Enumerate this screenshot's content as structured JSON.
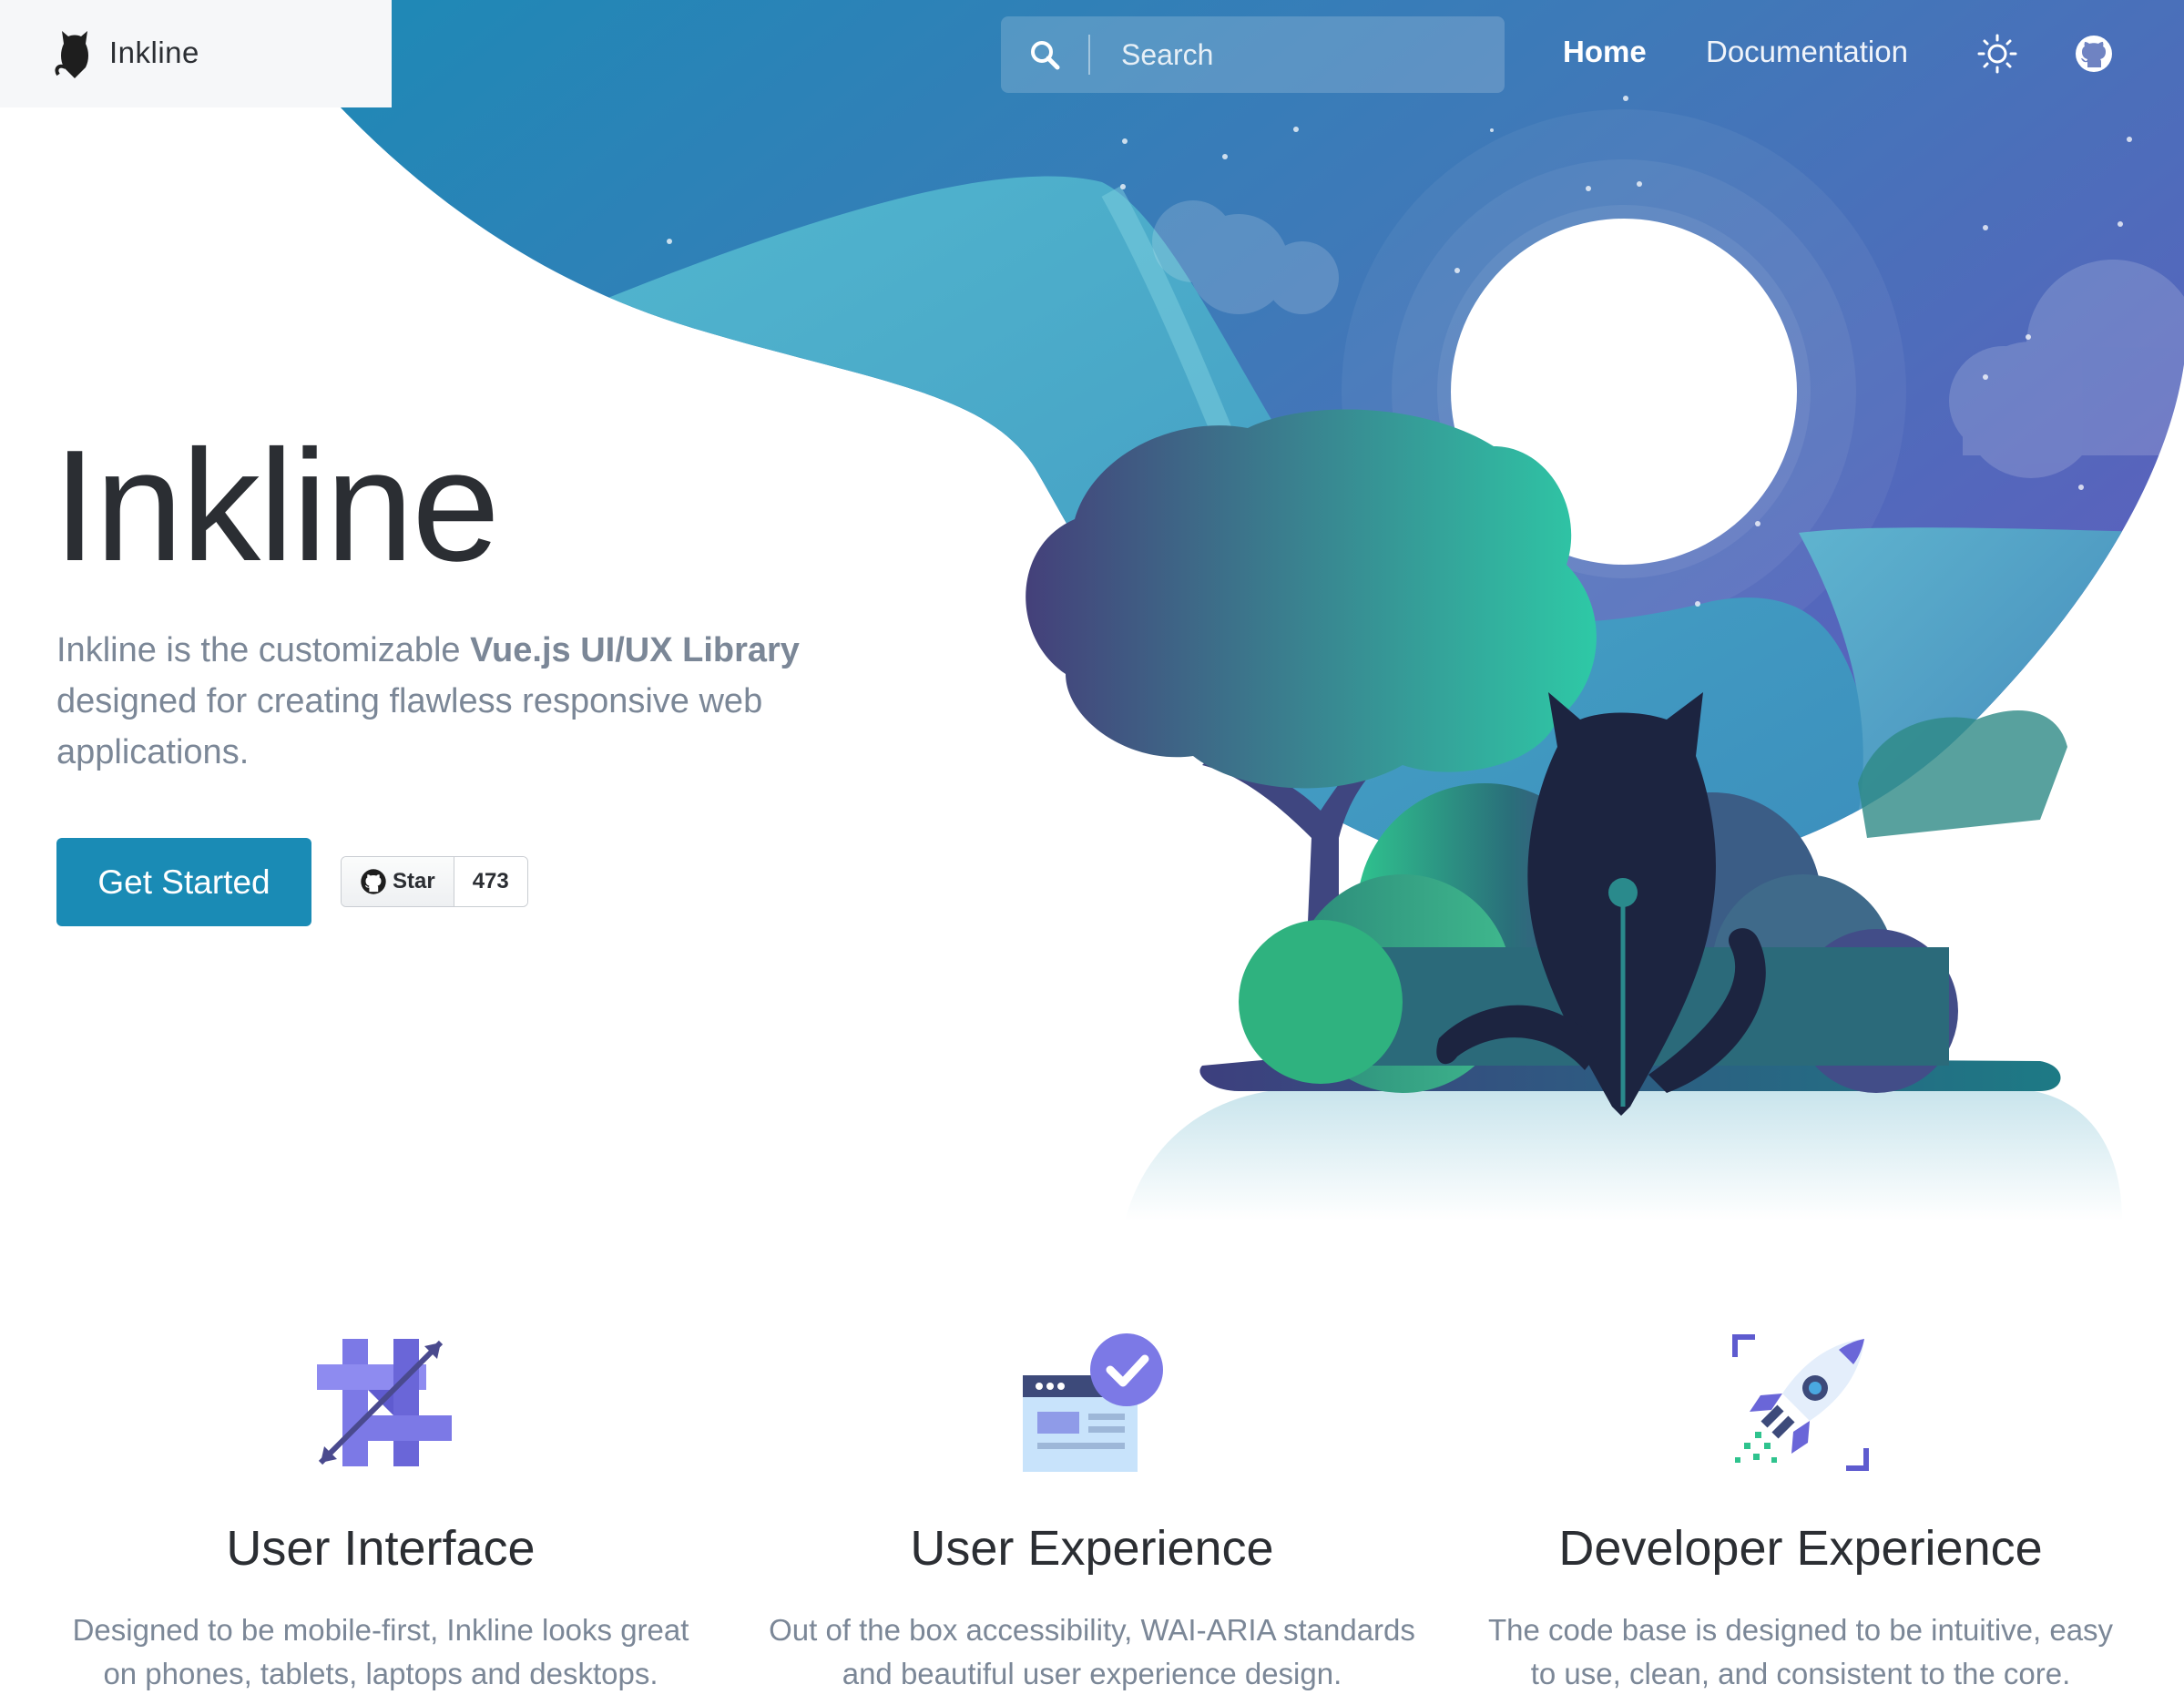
{
  "brand": {
    "name": "Inkline"
  },
  "nav": {
    "search_placeholder": "Search",
    "links": [
      {
        "label": "Home",
        "active": true
      },
      {
        "label": "Documentation",
        "active": false
      }
    ],
    "icons": [
      "sun-icon",
      "github-icon"
    ]
  },
  "hero": {
    "title": "Inkline",
    "description_prefix": "Inkline is the customizable ",
    "description_strong": "Vue.js UI/UX Library",
    "description_suffix": " designed for creating flawless responsive web applications.",
    "cta_label": "Get Started",
    "github": {
      "star_label": "Star",
      "star_count": "473"
    }
  },
  "features": [
    {
      "icon": "crop-icon",
      "title": "User Interface",
      "text": "Designed to be mobile-first, Inkline looks great on phones, tablets, laptops and desktops."
    },
    {
      "icon": "browser-check-icon",
      "title": "User Experience",
      "text": "Out of the box accessibility, WAI-ARIA standards and beautiful user experience design."
    },
    {
      "icon": "rocket-icon",
      "title": "Developer Experience",
      "text": "The code base is designed to be intuitive, easy to use, clean, and consistent to the core."
    }
  ],
  "colors": {
    "primary": "#1a8bb5",
    "hero_gradient_start": "#1a8bb5",
    "hero_gradient_end": "#5a63bd",
    "heading": "#2b2e33",
    "muted": "#7b8797"
  }
}
